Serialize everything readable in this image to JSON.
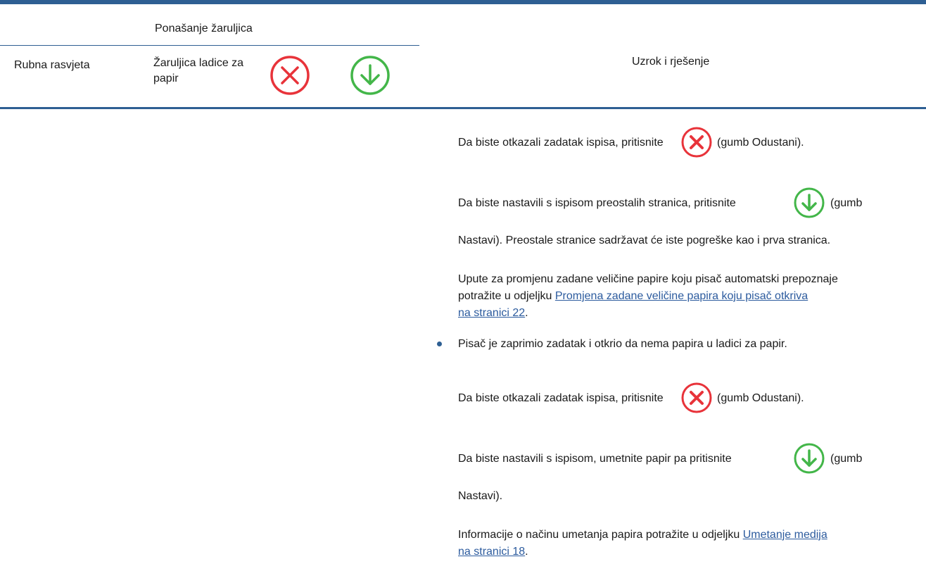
{
  "header": {
    "group_label": "Ponašanje žaruljica",
    "col_edge_light": "Rubna rasvjeta",
    "col_tray_light_line1": "Žaruljica ladice za",
    "col_tray_light_line2": "papir",
    "col_cancel_icon": "cancel-icon",
    "col_resume_icon": "resume-icon",
    "col_cause": "Uzrok i rješenje"
  },
  "content": {
    "p1_before": "Da biste otkazali zadatak ispisa, pritisnite",
    "p1_after": "(gumb Odustani).",
    "p2_before": "Da biste nastavili s ispisom preostalih stranica, pritisnite",
    "p2_after": "(gumb",
    "p2_line2": "Nastavi). Preostale stranice sadržavat će iste pogreške kao i prva stranica.",
    "p3_line1": "Upute za promjenu zadane veličine papire koju pisač automatski prepoznaje",
    "p3_line2_prefix": "potražite u odjeljku",
    "p3_link_line1": "Promjena zadane veličine papira koju pisač otkriva",
    "p3_link_line2": "na stranici 22",
    "p3_end": ".",
    "bullet_text": "Pisač je zaprimio zadatak i otkrio da nema papira u ladici za papir.",
    "p4_before": "Da biste otkazali zadatak ispisa, pritisnite",
    "p4_after": "(gumb Odustani).",
    "p5_before": "Da biste nastavili s ispisom, umetnite papir pa pritisnite",
    "p5_after": "(gumb",
    "p5_line2": "Nastavi).",
    "p6_line1_prefix": "Informacije o načinu umetanja papira potražite u odjeljku",
    "p6_link_line1": "Umetanje medija",
    "p6_link_line2": "na stranici 18",
    "p6_end": "."
  },
  "colors": {
    "rule": "#2e5f93",
    "link": "#2c5b9e",
    "cancel_red": "#e8333a",
    "resume_green": "#43b649"
  }
}
